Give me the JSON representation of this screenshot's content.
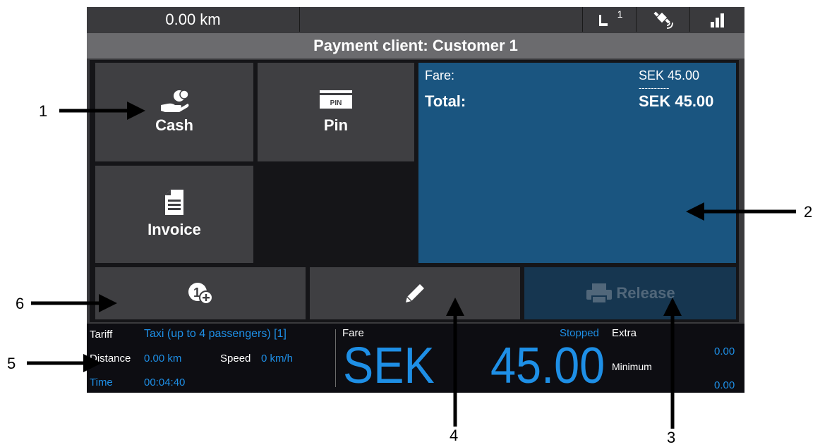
{
  "statusbar": {
    "distance": "0.00 km",
    "icons": [
      "seat-occupancy-icon",
      "satellite-icon",
      "signal-strength-icon"
    ],
    "seat_count": "1"
  },
  "title": "Payment client: Customer 1",
  "payment_buttons": {
    "cash": {
      "label": "Cash",
      "icon": "cash-hand-icon"
    },
    "pin": {
      "label": "Pin",
      "icon": "pin-card-icon",
      "icon_text": "PIN"
    },
    "invoice": {
      "label": "Invoice",
      "icon": "invoice-document-icon"
    }
  },
  "fare_box": {
    "fare_label": "Fare:",
    "fare_value": "SEK 45.00",
    "separator": "----------",
    "total_label": "Total:",
    "total_value": "SEK 45.00"
  },
  "bottom_buttons": {
    "add_customer_icon": "add-customer-icon",
    "edit_icon": "pencil-icon",
    "release_label": "Release",
    "release_icon": "printer-icon"
  },
  "meter": {
    "tariff_label": "Tariff",
    "tariff_value": "Taxi (up to 4 passengers) [1]",
    "distance_label": "Distance",
    "distance_value": "0.00 km",
    "speed_label": "Speed",
    "speed_value": "0 km/h",
    "time_label": "Time",
    "time_value": "00:04:40",
    "fare_label": "Fare",
    "currency": "SEK",
    "amount": "45.00",
    "status": "Stopped",
    "extra_label": "Extra",
    "extra_value": "0.00",
    "minimum_label": "Minimum",
    "minimum_value": "0.00"
  },
  "callouts": [
    "1",
    "2",
    "3",
    "4",
    "5",
    "6"
  ],
  "colors": {
    "accent_blue": "#1e8fe6",
    "fare_panel": "#1a5580",
    "button_bg": "#3f3f42",
    "release_disabled": "#163650"
  }
}
